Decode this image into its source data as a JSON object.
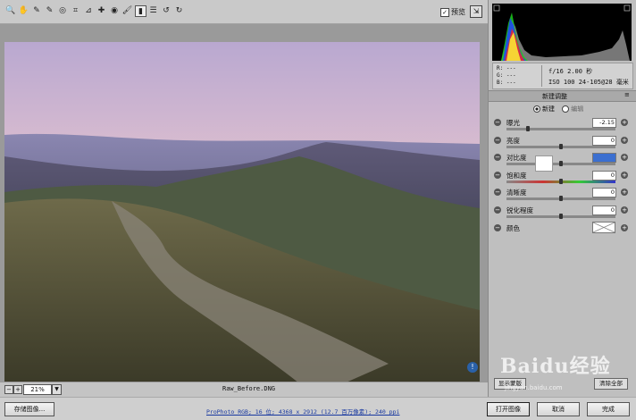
{
  "toolbar": {
    "tools": [
      {
        "icon": "zoom-icon",
        "glyph": "🔍"
      },
      {
        "icon": "hand-icon",
        "glyph": "✋"
      },
      {
        "icon": "white-balance-icon",
        "glyph": "✎"
      },
      {
        "icon": "color-sampler-icon",
        "glyph": "✎"
      },
      {
        "icon": "target-adjust-icon",
        "glyph": "◎"
      },
      {
        "icon": "crop-icon",
        "glyph": "⌗"
      },
      {
        "icon": "straighten-icon",
        "glyph": "⊿"
      },
      {
        "icon": "spot-removal-icon",
        "glyph": "✚"
      },
      {
        "icon": "red-eye-icon",
        "glyph": "◉"
      },
      {
        "icon": "adjustment-brush-icon",
        "glyph": "🖌"
      },
      {
        "icon": "graduated-filter-icon",
        "glyph": "▮"
      },
      {
        "icon": "preferences-icon",
        "glyph": "☰"
      },
      {
        "icon": "rotate-left-icon",
        "glyph": "↺"
      },
      {
        "icon": "rotate-right-icon",
        "glyph": "↻"
      }
    ],
    "preview_label": "预览",
    "preview_checked": "✓"
  },
  "canvas": {
    "zoom_value": "21%",
    "filename": "Raw_Before.DNG"
  },
  "camera_info": {
    "r": "R:  ---",
    "g": "G:  ---",
    "b": "B:  ---",
    "line1": "f/16  2.00 秒",
    "line2": "ISO 100  24-105@28 毫米"
  },
  "panel": {
    "title": "新建调整",
    "menu": "≡",
    "mode_new": "新建",
    "mode_edit": "编辑",
    "sliders": [
      {
        "label": "曝光",
        "value": "-2.15",
        "level": 0.2
      },
      {
        "label": "亮度",
        "value": "0",
        "level": 0.5
      },
      {
        "label": "对比度",
        "value": "",
        "level": 0.5
      },
      {
        "label": "饱和度",
        "value": "0",
        "level": 0.5
      },
      {
        "label": "清晰度",
        "value": "0",
        "level": 0.5
      },
      {
        "label": "锐化程度",
        "value": "0",
        "level": 0.5
      }
    ],
    "color_label": "颜色",
    "preset_label": "显示蒙版",
    "reset_label": "清除全部"
  },
  "footer": {
    "save_label": "存储图像...",
    "workflow_text": "ProPhoto RGB; 16 位; 4368 x 2912 (12.7 百万像素); 240 ppi",
    "open_label": "打开图像",
    "cancel_label": "取消",
    "done_label": "完成"
  },
  "watermark": {
    "text": "Baidu经验",
    "sub": "jingyan.baidu.com"
  }
}
